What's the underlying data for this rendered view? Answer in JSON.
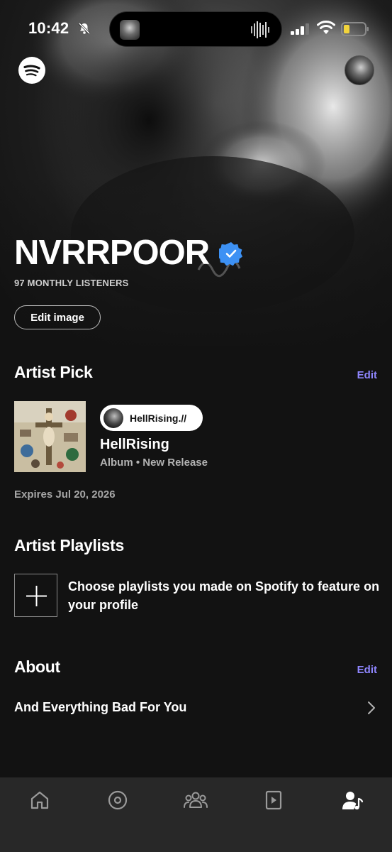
{
  "status_bar": {
    "time": "10:42",
    "icons": [
      "mute-icon",
      "signal-icon",
      "wifi-icon",
      "battery-icon"
    ]
  },
  "header": {
    "icons": [
      "spotify-logo",
      "profile-avatar"
    ]
  },
  "artist": {
    "name": "NVRRPOOR",
    "verified": true,
    "monthly_listeners": "97 MONTHLY LISTENERS",
    "edit_image_label": "Edit image"
  },
  "artist_pick": {
    "title": "Artist Pick",
    "edit_label": "Edit",
    "chip_label": "HellRising.//",
    "release_title": "HellRising",
    "release_subtitle": "Album • New Release",
    "expires": "Expires Jul 20, 2026"
  },
  "artist_playlists": {
    "title": "Artist Playlists",
    "prompt": "Choose playlists you made on Spotify to feature on your profile"
  },
  "about": {
    "title": "About",
    "edit_label": "Edit",
    "bio": "And Everything Bad For You"
  },
  "bottom_nav": {
    "items": [
      "home-icon",
      "music-icon",
      "audience-icon",
      "video-icon",
      "profile-icon"
    ],
    "active": "profile-icon"
  },
  "colors": {
    "background": "#121212",
    "accent": "#8f86ff",
    "verified": "#3d91f4",
    "nav_background": "#282828"
  }
}
